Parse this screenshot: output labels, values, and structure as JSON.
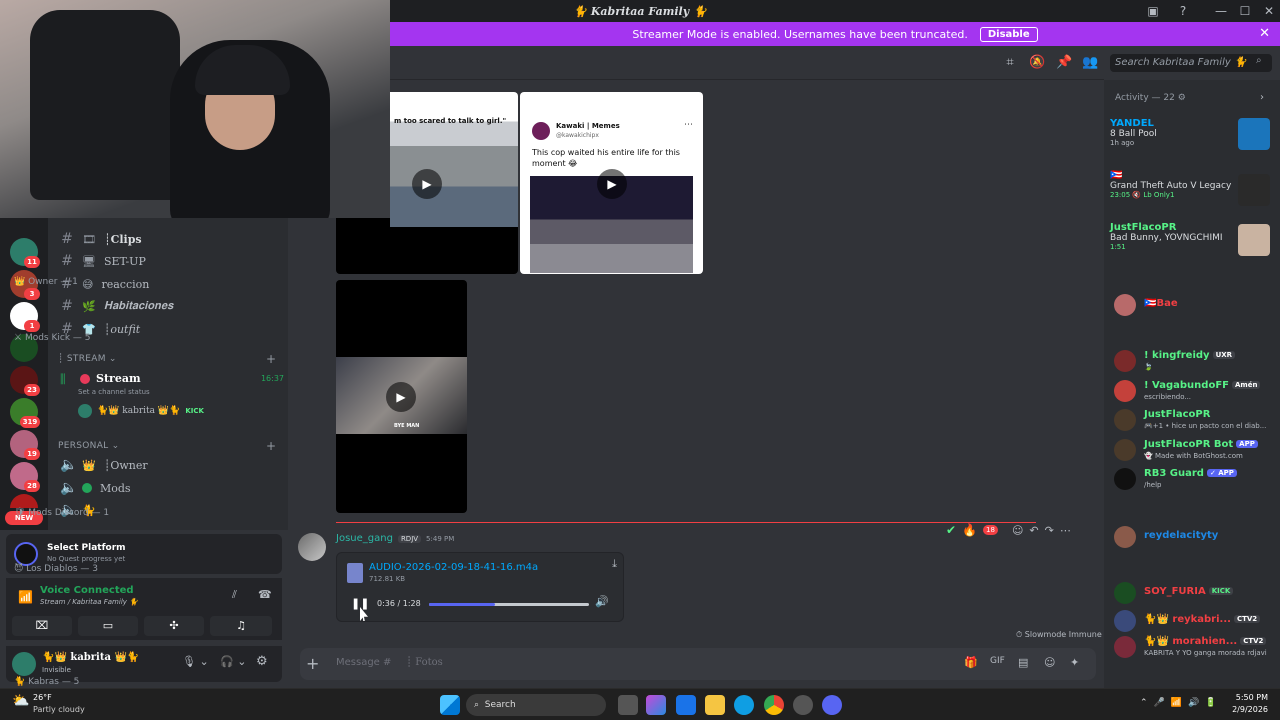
{
  "window": {
    "title": "🐈 Kabritaa Family 🐈"
  },
  "banner": {
    "text": "Streamer Mode is enabled. Usernames have been truncated.",
    "button": "Disable"
  },
  "header": {
    "search_placeholder": "Search Kabritaa Family 🐈"
  },
  "servers": {
    "badges": [
      "11",
      "3",
      "1",
      "23",
      "319",
      "19",
      "28"
    ],
    "new_label": "NEW"
  },
  "channels": {
    "items": [
      {
        "name": "┊Clips",
        "icon": "clips-emoji"
      },
      {
        "name": "SET-UP",
        "icon": "monitor-emoji"
      },
      {
        "name": "reaccion",
        "icon": "sweat-emoji"
      },
      {
        "name": "𝐇𝐚𝐛𝐢𝐭𝐚𝐜𝐢𝐨𝐧𝐞𝐬",
        "icon": "plant-emoji"
      },
      {
        "name": "┊outfit",
        "icon": "shirt-emoji"
      }
    ],
    "stream_category": "STREAM",
    "stream_channel": "Stream",
    "stream_time": "16:37",
    "stream_status": "Set a channel status",
    "stream_user": "kabrita",
    "stream_user_badge": "KICK",
    "personal_category": "PERSONAL",
    "personal_items": [
      "┊Owner",
      "Mods",
      "🐈"
    ]
  },
  "quest": {
    "title": "Select Platform",
    "subtitle": "No Quest progress yet"
  },
  "voice": {
    "status": "Voice Connected",
    "location": "Stream / Kabritaa Family 🐈"
  },
  "user": {
    "name": "kabrita",
    "status": "Invisible"
  },
  "media": {
    "video1_caption": "m too scared to talk to girl.\"",
    "tweet_author": "Kawaki | Memes",
    "tweet_handle": "@kawakichipx",
    "tweet_text": "This cop waited his entire life for this moment 😂",
    "video3_caption": "BYE MAN"
  },
  "message": {
    "author": "Josue_gang",
    "author_tag": "RDJV",
    "time": "5:49 PM",
    "reaction_count": "18",
    "audio": {
      "filename": "AUDIO-2026-02-09-18-41-16.m4a",
      "size": "712.81 KB",
      "position": "0:36 / 1:28",
      "progress": 0.41
    },
    "slowmode": "Slowmode Immune"
  },
  "input": {
    "placeholder": "Message #",
    "channel_part": "┊ Fotos"
  },
  "activity": {
    "header": "Activity — 22",
    "items": [
      {
        "name": "YANDEL",
        "game": "8 Ball Pool",
        "time": "1h ago",
        "color": "#00a8fc",
        "art": "#1b75bb"
      },
      {
        "name": "🇵🇷",
        "game": "Grand Theft Auto V Legacy",
        "time": "23:05 🔇 Lb Only1",
        "color": "#5865f2",
        "art": "#2a2a2a"
      },
      {
        "name": "JustFlacoPR",
        "game": "Bad Bunny, YOVNGCHIMI",
        "time": "1:51",
        "color": "#23a55a",
        "art": "#c9b3a1"
      }
    ]
  },
  "members": {
    "owner_header": "Owner — 1",
    "owner": {
      "name": "🇵🇷Bae",
      "color": "#f23f43"
    },
    "mods_kick_header": "Mods Kick — 5",
    "mods_kick": [
      {
        "name": "! kingfreidy",
        "tag": "UXR",
        "sub": "🍃",
        "color": "#57f287"
      },
      {
        "name": "! VagabundoFF",
        "tag": "Amén",
        "sub": "escribiendo...",
        "color": "#57f287"
      },
      {
        "name": "JustFlacoPR",
        "tag": "",
        "sub": "🎮+1 • hice un pacto con el diab...",
        "color": "#57f287"
      },
      {
        "name": "JustFlacoPR Bot",
        "tag": "APP",
        "sub": "👻 Made with BotGhost.com",
        "color": "#57f287"
      },
      {
        "name": "RB3 Guard",
        "tag": "✓ APP",
        "sub": "/help",
        "color": "#57f287"
      }
    ],
    "mods_discord_header": "Mods Discord — 1",
    "mods_discord": {
      "name": "reydelacityty",
      "color": "#1e88e5"
    },
    "diablos_header": "Los Diablos — 3",
    "diablos": [
      {
        "name": "SOY_FURIA",
        "tag": "KICK",
        "sub": "",
        "color": "#f23f43"
      },
      {
        "name": "🐈👑 reykabri...",
        "tag": "CTV2",
        "sub": "",
        "color": "#f23f43"
      },
      {
        "name": "🐈👑 morahien...",
        "tag": "CTV2",
        "sub": "KABRITA Y YO ganga morada rdjavi",
        "color": "#f23f43"
      }
    ],
    "kabras_header": "Kabras — 5"
  },
  "taskbar": {
    "weather_temp": "26°F",
    "weather_desc": "Partly cloudy",
    "search": "Search",
    "time": "5:50 PM",
    "date": "2/9/2026"
  }
}
